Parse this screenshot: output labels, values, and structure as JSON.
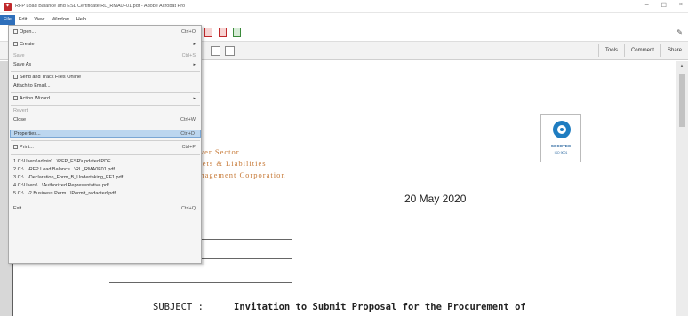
{
  "window": {
    "title": "RFP Load Balance and ESL Certificate RL_RMA0F01.pdf - Adobe Acrobat Pro",
    "controls": [
      "–",
      "☐",
      "×"
    ]
  },
  "menubar": [
    "File",
    "Edit",
    "View",
    "Window",
    "Help"
  ],
  "toolbar": {
    "right_tabs": [
      "Tools",
      "Comment",
      "Share"
    ]
  },
  "file_menu": {
    "items": [
      {
        "label": "Open...",
        "shortcut": "Ctrl+O",
        "disabled": false
      },
      {
        "label": "Create",
        "shortcut": "",
        "submenu": true
      },
      {
        "label": "Save",
        "shortcut": "Ctrl+S",
        "disabled": true
      },
      {
        "label": "Save As",
        "shortcut": "",
        "submenu": true
      },
      {
        "label": "Send and Track Files Online",
        "shortcut": ""
      },
      {
        "label": "Attach to Email...",
        "shortcut": ""
      },
      {
        "label": "Action Wizard",
        "shortcut": "",
        "submenu": true
      },
      {
        "label": "Revert",
        "shortcut": "",
        "disabled": true
      },
      {
        "label": "Close",
        "shortcut": "Ctrl+W"
      },
      {
        "label": "Properties...",
        "shortcut": "Ctrl+D",
        "highlighted": true
      },
      {
        "label": "Print...",
        "shortcut": "Ctrl+P"
      },
      {
        "label": "1 C:\\Users\\admin\\...\\RFP_ESR\\updated.PDF",
        "shortcut": ""
      },
      {
        "label": "2 C:\\...\\RFP Load Balance...\\RL_RMA0F01.pdf",
        "shortcut": ""
      },
      {
        "label": "3 C:\\...\\Declaration_Form_B_Undertaking_EF1.pdf",
        "shortcut": ""
      },
      {
        "label": "4 C:\\Users\\...\\Authorized Representative.pdf",
        "shortcut": ""
      },
      {
        "label": "5 C:\\...\\2 Business Perm...\\Permit_redacted.pdf",
        "shortcut": ""
      },
      {
        "label": "Exit",
        "shortcut": "Ctrl+Q"
      }
    ]
  },
  "document": {
    "org_lines": [
      "Power Sector",
      "Assets & Liabilities",
      "Management Corporation"
    ],
    "badge": {
      "text": "SOCOTEC",
      "sub": "ISO 9001"
    },
    "date": "20 May 2020",
    "subject_label": "SUBJECT  :",
    "subject_text": "Invitation to Submit Proposal for the Procurement of"
  },
  "colors": {
    "accent": "#2e6fbb",
    "org_text": "#c77a38",
    "badge_blue": "#1f7dc1",
    "menu_highlight": "#bcd6ef"
  }
}
